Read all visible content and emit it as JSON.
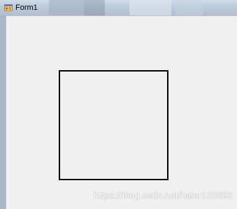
{
  "window": {
    "title": "Form1"
  },
  "watermark": {
    "text": "https://blog.csdn.net/haier123888"
  },
  "colors": {
    "client_background": "#f0f0f0",
    "rectangle_stroke": "#000000"
  },
  "icons": {
    "app": "form-app-icon"
  }
}
